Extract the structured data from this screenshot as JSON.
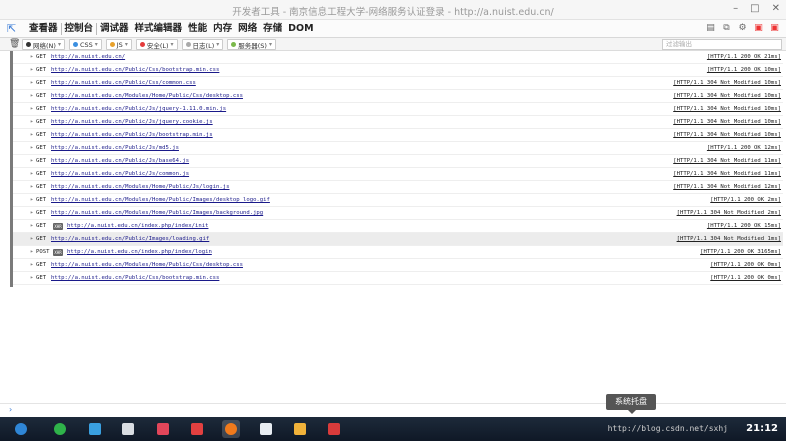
{
  "window": {
    "title": "开发者工具 - 南京信息工程大学-网络服务认证登录 - http://a.nuist.edu.cn/",
    "controls": [
      "–",
      "□",
      "✕"
    ]
  },
  "devtools": {
    "tabs": [
      "查看器",
      "控制台",
      "调试器",
      "样式编辑器",
      "性能",
      "内存",
      "网络",
      "存储",
      "DOM"
    ],
    "active_tab": "控制台"
  },
  "filters": {
    "buttons": [
      {
        "label": "网络(N)",
        "color": "#333333"
      },
      {
        "label": "CSS",
        "color": "#3b8fe0"
      },
      {
        "label": "JS",
        "color": "#e8a12b"
      },
      {
        "label": "安全(L)",
        "color": "#e33b3b"
      },
      {
        "label": "日志(L)",
        "color": "#aaaaaa"
      },
      {
        "label": "服务器(S)",
        "color": "#7ab84a"
      }
    ],
    "search_placeholder": "过滤输出"
  },
  "log_rows": [
    {
      "method": "GET",
      "url": "http://a.nuist.edu.cn/",
      "status": "[HTTP/1.1 200 OK 21ms]",
      "xhr": false
    },
    {
      "method": "GET",
      "url": "http://a.nuist.edu.cn/Public/Css/bootstrap.min.css",
      "status": "[HTTP/1.1 200 OK 10ms]",
      "xhr": false
    },
    {
      "method": "GET",
      "url": "http://a.nuist.edu.cn/Public/Css/common.css",
      "status": "[HTTP/1.1 304 Not Modified 10ms]",
      "xhr": false
    },
    {
      "method": "GET",
      "url": "http://a.nuist.edu.cn/Modules/Home/Public/Css/desktop.css",
      "status": "[HTTP/1.1 304 Not Modified 10ms]",
      "xhr": false
    },
    {
      "method": "GET",
      "url": "http://a.nuist.edu.cn/Public/Js/jquery-1.11.0.min.js",
      "status": "[HTTP/1.1 304 Not Modified 10ms]",
      "xhr": false
    },
    {
      "method": "GET",
      "url": "http://a.nuist.edu.cn/Public/Js/jquery.cookie.js",
      "status": "[HTTP/1.1 304 Not Modified 10ms]",
      "xhr": false
    },
    {
      "method": "GET",
      "url": "http://a.nuist.edu.cn/Public/Js/bootstrap.min.js",
      "status": "[HTTP/1.1 304 Not Modified 10ms]",
      "xhr": false
    },
    {
      "method": "GET",
      "url": "http://a.nuist.edu.cn/Public/Js/md5.js",
      "status": "[HTTP/1.1 200 OK 12ms]",
      "xhr": false
    },
    {
      "method": "GET",
      "url": "http://a.nuist.edu.cn/Public/Js/base64.js",
      "status": "[HTTP/1.1 304 Not Modified 11ms]",
      "xhr": false
    },
    {
      "method": "GET",
      "url": "http://a.nuist.edu.cn/Public/Js/common.js",
      "status": "[HTTP/1.1 304 Not Modified 11ms]",
      "xhr": false
    },
    {
      "method": "GET",
      "url": "http://a.nuist.edu.cn/Modules/Home/Public/Js/login.js",
      "status": "[HTTP/1.1 304 Not Modified 12ms]",
      "xhr": false
    },
    {
      "method": "GET",
      "url": "http://a.nuist.edu.cn/Modules/Home/Public/Images/desktop_logo.gif",
      "status": "[HTTP/1.1 200 OK 2ms]",
      "xhr": false
    },
    {
      "method": "GET",
      "url": "http://a.nuist.edu.cn/Modules/Home/Public/Images/background.jpg",
      "status": "[HTTP/1.1 304 Not Modified 2ms]",
      "xhr": false
    },
    {
      "method": "GET",
      "url": "http://a.nuist.edu.cn/index.php/index/init",
      "status": "[HTTP/1.1 200 OK 15ms]",
      "xhr": true
    },
    {
      "method": "GET",
      "url": "http://a.nuist.edu.cn/Public/Images/loading.gif",
      "status": "[HTTP/1.1 304 Not Modified 1ms]",
      "xhr": false,
      "highlight": true
    },
    {
      "method": "POST",
      "url": "http://a.nuist.edu.cn/index.php/index/login",
      "status": "[HTTP/1.1 200 OK 3165ms]",
      "xhr": true
    },
    {
      "method": "GET",
      "url": "http://a.nuist.edu.cn/Modules/Home/Public/Css/desktop.css",
      "status": "[HTTP/1.1 200 OK 0ms]",
      "xhr": false
    },
    {
      "method": "GET",
      "url": "http://a.nuist.edu.cn/Public/Css/bootstrap.min.css",
      "status": "[HTTP/1.1 200 OK 0ms]",
      "xhr": false
    }
  ],
  "xhr_badge": "XHR",
  "console_prompt": "›",
  "tooltip": "系统托盘",
  "taskbar": {
    "apps": [
      {
        "name": "launcher",
        "color": "#2f86d6"
      },
      {
        "name": "wechat-alt",
        "color": "#2fb34a"
      },
      {
        "name": "files",
        "color": "#3aa0e0"
      },
      {
        "name": "trash",
        "color": "#d9dde2"
      },
      {
        "name": "screenshot",
        "color": "#e2465a"
      },
      {
        "name": "presentation",
        "color": "#e24040"
      },
      {
        "name": "firefox",
        "color": "#f07a1c"
      },
      {
        "name": "wechat",
        "color": "#e8edf2"
      },
      {
        "name": "game",
        "color": "#f0b23a"
      },
      {
        "name": "terminal",
        "color": "#d93b3b"
      }
    ],
    "status_text": "http://blog.csdn.net/sxhj",
    "clock": "21:12"
  }
}
